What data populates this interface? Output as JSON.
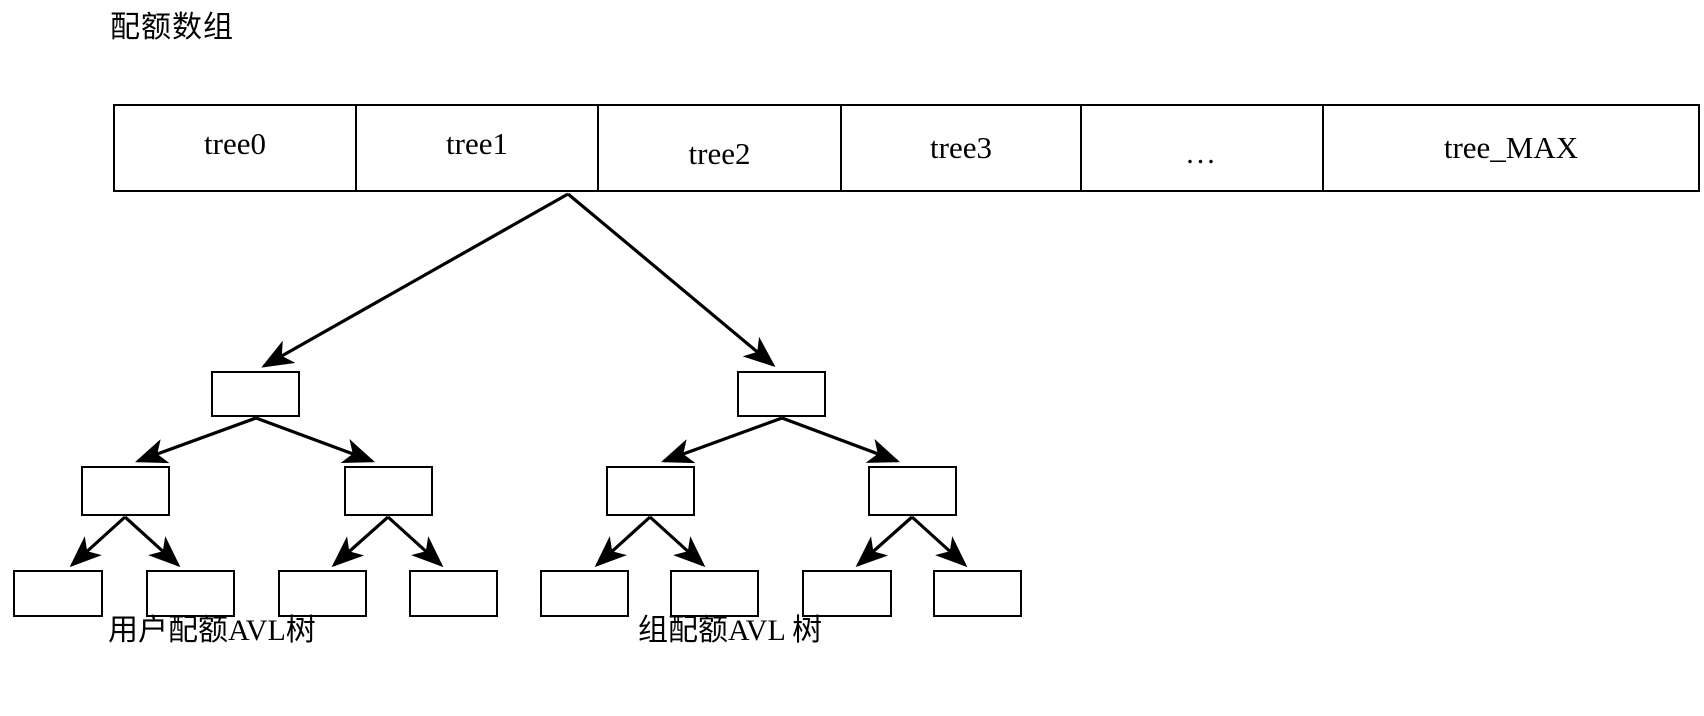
{
  "diagram": {
    "title": "配额数组",
    "type": "structure-diagram"
  },
  "quota_array": {
    "label": "配额数组",
    "cells": [
      {
        "label": "tree0"
      },
      {
        "label": "tree1"
      },
      {
        "label": "tree2"
      },
      {
        "label": "tree3"
      },
      {
        "label": "..."
      },
      {
        "label": "tree_MAX"
      }
    ]
  },
  "trees": [
    {
      "caption": "用户配额AVL树",
      "source_cell": "tree1",
      "levels": [
        1,
        2,
        4
      ],
      "nodes": 7
    },
    {
      "caption": "组配额AVL 树",
      "source_cell": "tree1",
      "levels": [
        1,
        2,
        4
      ],
      "nodes": 7
    }
  ],
  "captions": {
    "user_tree": "用户配额AVL树",
    "group_tree": "组配额AVL 树"
  },
  "colors": {
    "stroke": "#000000",
    "background": "#ffffff",
    "node_fill": "#ffffff"
  }
}
